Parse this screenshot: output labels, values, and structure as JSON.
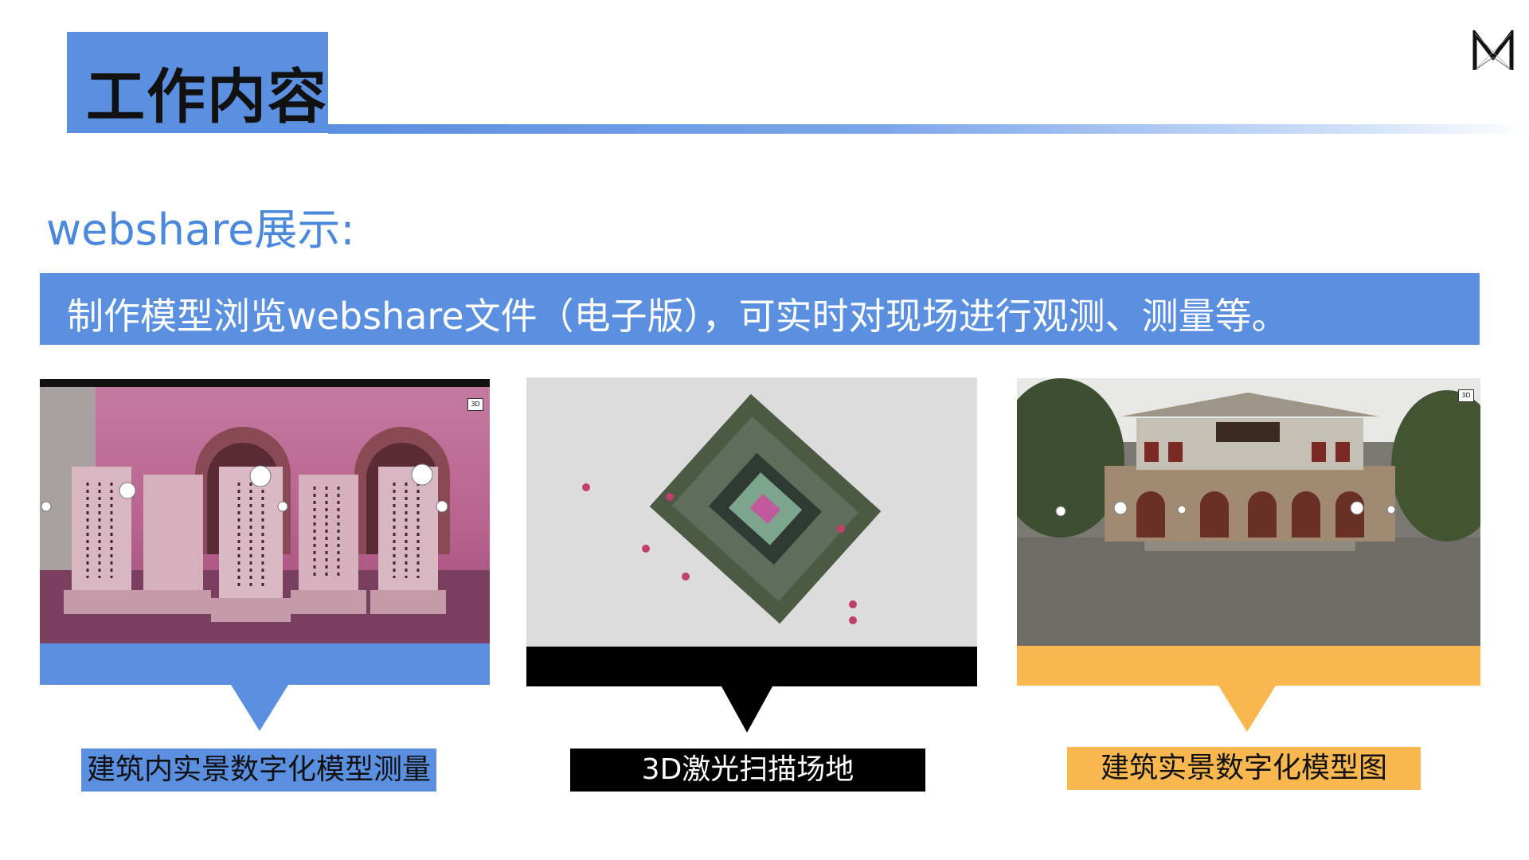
{
  "header": {
    "title": "工作内容"
  },
  "subtitle": "webshare展示:",
  "banner": {
    "text": "制作模型浏览webshare文件（电子版），可实时对现场进行观测、测量等。"
  },
  "panels": [
    {
      "caption": "建筑内实景数字化模型测量",
      "badge": "3D",
      "accent": "#5b8fe0"
    },
    {
      "caption": "3D激光扫描场地",
      "accent": "#000000"
    },
    {
      "caption": "建筑实景数字化模型图",
      "badge": "3D",
      "accent": "#f9b84f"
    }
  ],
  "colors": {
    "primary": "#5b8fe0",
    "subtitle": "#4a88de",
    "orange": "#f9b84f"
  }
}
